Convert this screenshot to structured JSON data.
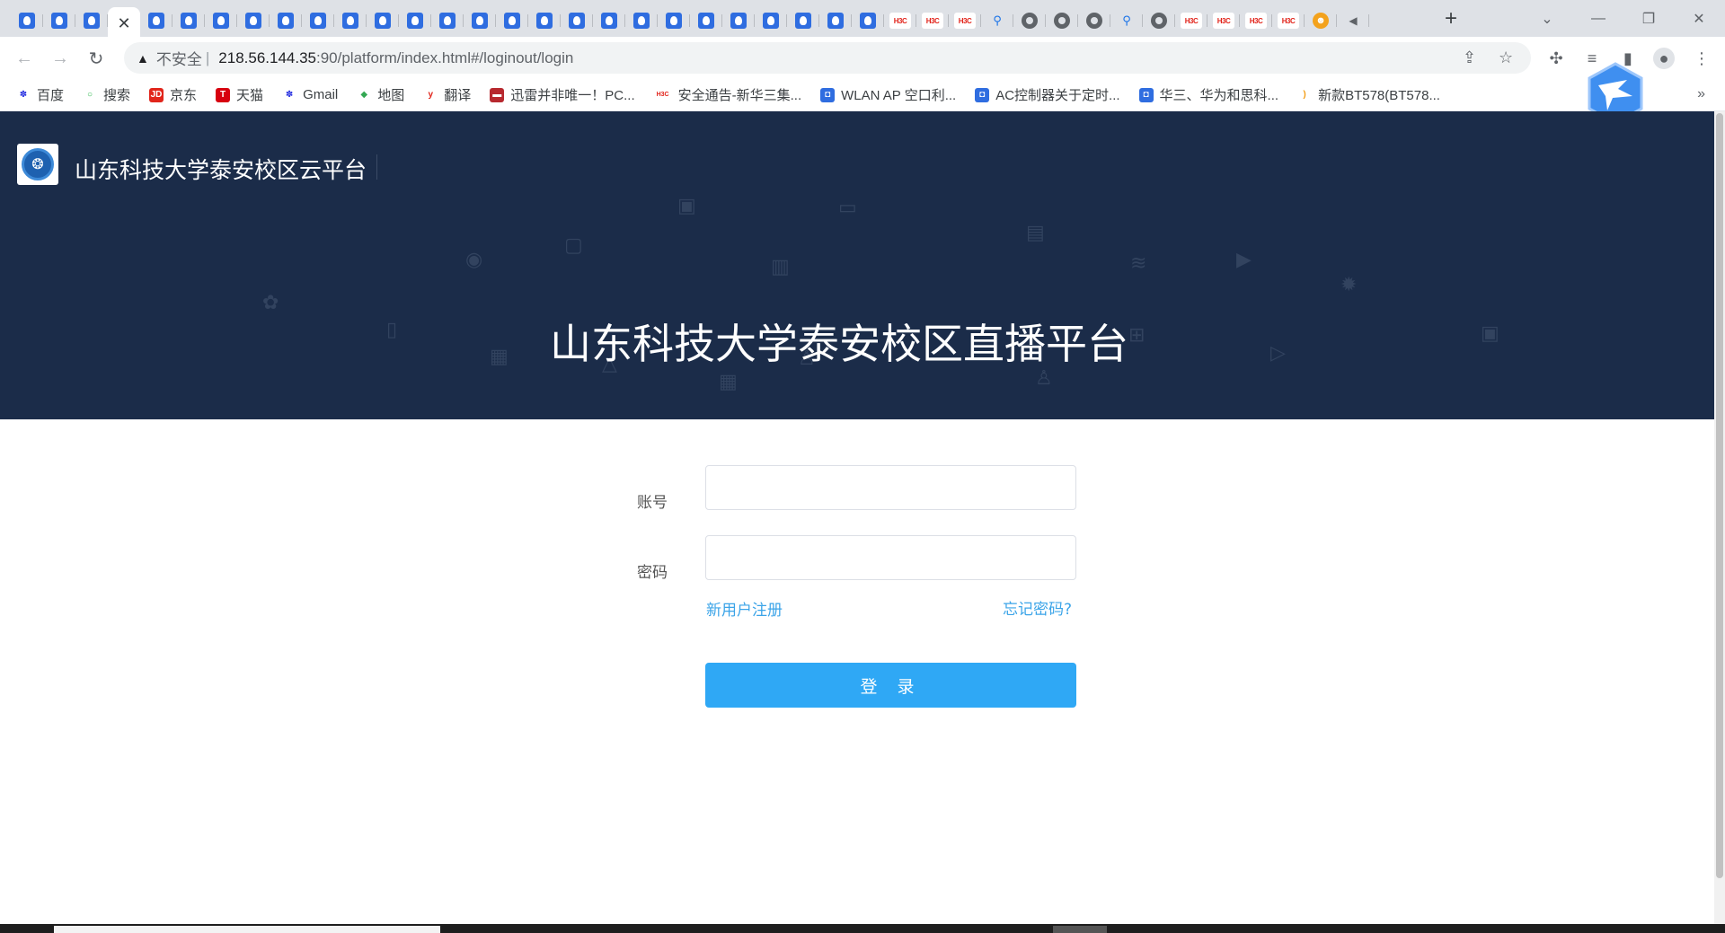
{
  "browser": {
    "tabs": [
      {
        "icon": "qq"
      },
      {
        "icon": "qq"
      },
      {
        "icon": "qq"
      },
      {
        "icon": "close",
        "active": true
      },
      {
        "icon": "qq"
      },
      {
        "icon": "qq"
      },
      {
        "icon": "qq"
      },
      {
        "icon": "qq"
      },
      {
        "icon": "qq"
      },
      {
        "icon": "qq"
      },
      {
        "icon": "qq"
      },
      {
        "icon": "qq"
      },
      {
        "icon": "qq"
      },
      {
        "icon": "qq"
      },
      {
        "icon": "qq"
      },
      {
        "icon": "qq"
      },
      {
        "icon": "qq"
      },
      {
        "icon": "qq"
      },
      {
        "icon": "qq"
      },
      {
        "icon": "qq"
      },
      {
        "icon": "qq"
      },
      {
        "icon": "qq"
      },
      {
        "icon": "qq"
      },
      {
        "icon": "qq"
      },
      {
        "icon": "qq"
      },
      {
        "icon": "qq"
      },
      {
        "icon": "qq"
      },
      {
        "icon": "h3c",
        "text": "H3C"
      },
      {
        "icon": "h3c",
        "text": "H3C"
      },
      {
        "icon": "h3c",
        "text": "H3C"
      },
      {
        "icon": "search"
      },
      {
        "icon": "globe"
      },
      {
        "icon": "globe"
      },
      {
        "icon": "globe"
      },
      {
        "icon": "search"
      },
      {
        "icon": "globe"
      },
      {
        "icon": "h3c",
        "text": "H3C"
      },
      {
        "icon": "h3c",
        "text": "H3C"
      },
      {
        "icon": "h3c",
        "text": "H3C"
      },
      {
        "icon": "h3c",
        "text": "H3C"
      },
      {
        "icon": "cat"
      },
      {
        "icon": "audio"
      }
    ],
    "close_glyph": "✕",
    "new_tab_glyph": "+",
    "address": {
      "warning_label": "不安全",
      "separator": "|",
      "host": "218.56.144.35",
      "rest": ":90/platform/index.html#/loginout/login"
    },
    "bookmarks": [
      {
        "label": "百度",
        "icon": "baidu-paw",
        "color": "#2932e1"
      },
      {
        "label": "搜索",
        "icon": "search-ring",
        "color": "#2db84d"
      },
      {
        "label": "京东",
        "icon": "jd",
        "color": "#e1251b"
      },
      {
        "label": "天猫",
        "icon": "tmall",
        "color": "#d7000f"
      },
      {
        "label": "Gmail",
        "icon": "baidu-paw",
        "color": "#2932e1"
      },
      {
        "label": "地图",
        "icon": "maps",
        "color": "#34a853"
      },
      {
        "label": "翻译",
        "icon": "youdao",
        "color": "#e1251b"
      },
      {
        "label": "迅雷并非唯一！PC...",
        "icon": "xunlei",
        "color": "#b7282e"
      },
      {
        "label": "安全通告-新华三集...",
        "icon": "h3c",
        "color": "#e2231a"
      },
      {
        "label": "WLAN AP 空口利...",
        "icon": "qq",
        "color": "#2f6de0"
      },
      {
        "label": "AC控制器关于定时...",
        "icon": "qq",
        "color": "#2f6de0"
      },
      {
        "label": "华三、华为和思科...",
        "icon": "qq",
        "color": "#2f6de0"
      },
      {
        "label": "新款BT578(BT578...",
        "icon": "rss",
        "color": "#f39c12"
      }
    ],
    "bookmarks_overflow": "»"
  },
  "page": {
    "site_name": "山东科技大学泰安校区云平台",
    "hero_title": "山东科技大学泰安校区直播平台",
    "form": {
      "account_label": "账号",
      "account_value": "",
      "password_label": "密码",
      "password_value": "",
      "register_link": "新用户注册",
      "forgot_link": "忘记密码?",
      "login_button": "登 录"
    }
  },
  "colors": {
    "hero_bg": "#1b2c49",
    "accent": "#2fa8f5",
    "link": "#3ba4e8"
  }
}
